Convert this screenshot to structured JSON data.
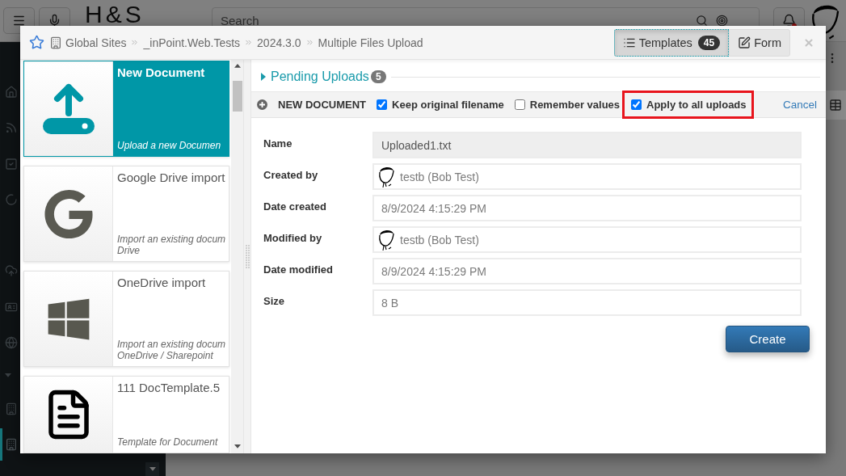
{
  "app": {
    "logo": "H&S",
    "search": {
      "placeholder": "Search"
    },
    "notifications": {
      "unread": true
    },
    "sidebar": {
      "sections": [
        {
          "items": [
            {
              "kind": "home",
              "selected": false
            },
            {
              "kind": "feed",
              "selected": false
            },
            {
              "kind": "tasks",
              "selected": false
            },
            {
              "kind": "spinner",
              "selected": false
            }
          ]
        },
        {
          "items": [
            {
              "kind": "cloud",
              "selected": false
            },
            {
              "kind": "card",
              "selected": false
            },
            {
              "kind": "globe",
              "selected": false
            }
          ]
        },
        {
          "expanded": true,
          "items": [
            {
              "kind": "building",
              "selected": false
            },
            {
              "kind": "building",
              "selected": true
            }
          ]
        }
      ]
    }
  },
  "dialog": {
    "favorite": false,
    "breadcrumb": [
      "Global Sites",
      "_inPoint.Web.Tests",
      "2024.3.0",
      "Multiple Files Upload"
    ],
    "view_tabs": [
      {
        "kind": "templates",
        "label": "Templates",
        "count": "45",
        "selected": true
      },
      {
        "kind": "form",
        "label": "Form",
        "selected": false
      }
    ],
    "templates": [
      {
        "kind": "upload",
        "title": "New Document",
        "description": [
          "Upload a new Documen"
        ],
        "selected": true
      },
      {
        "kind": "google",
        "title": "Google Drive import",
        "description": [
          "Import an existing docum",
          "Drive"
        ],
        "selected": false
      },
      {
        "kind": "onedrive",
        "title": "OneDrive import",
        "description": [
          "Import an existing docum",
          "OneDrive / Sharepoint"
        ],
        "selected": false
      },
      {
        "kind": "document",
        "title": "111 DocTemplate.5",
        "description": [
          "Template for Document"
        ],
        "selected": false
      }
    ],
    "pending_uploads": {
      "label": "Pending Uploads",
      "count": "5",
      "expanded": false
    },
    "upload_bar": {
      "title": "NEW DOCUMENT",
      "options": [
        {
          "label": "Keep original filename",
          "checked": true,
          "highlighted": false
        },
        {
          "label": "Remember values",
          "checked": false,
          "highlighted": false
        },
        {
          "label": "Apply to all uploads",
          "checked": true,
          "highlighted": true
        }
      ],
      "cancel": "Cancel"
    },
    "fields": [
      {
        "kind": "text",
        "label": "Name",
        "value": "Uploaded1.txt",
        "readonly": true
      },
      {
        "kind": "user",
        "label": "Created by",
        "value": "testb (Bob Test)",
        "readonly": false
      },
      {
        "kind": "text",
        "label": "Date created",
        "value": "8/9/2024 4:15:29 PM",
        "readonly": false
      },
      {
        "kind": "user",
        "label": "Modified by",
        "value": "testb (Bob Test)",
        "readonly": false
      },
      {
        "kind": "text",
        "label": "Date modified",
        "value": "8/9/2024 4:15:29 PM",
        "readonly": false
      },
      {
        "kind": "text",
        "label": "Size",
        "value": "8 B",
        "readonly": false
      }
    ],
    "submit": "Create"
  }
}
